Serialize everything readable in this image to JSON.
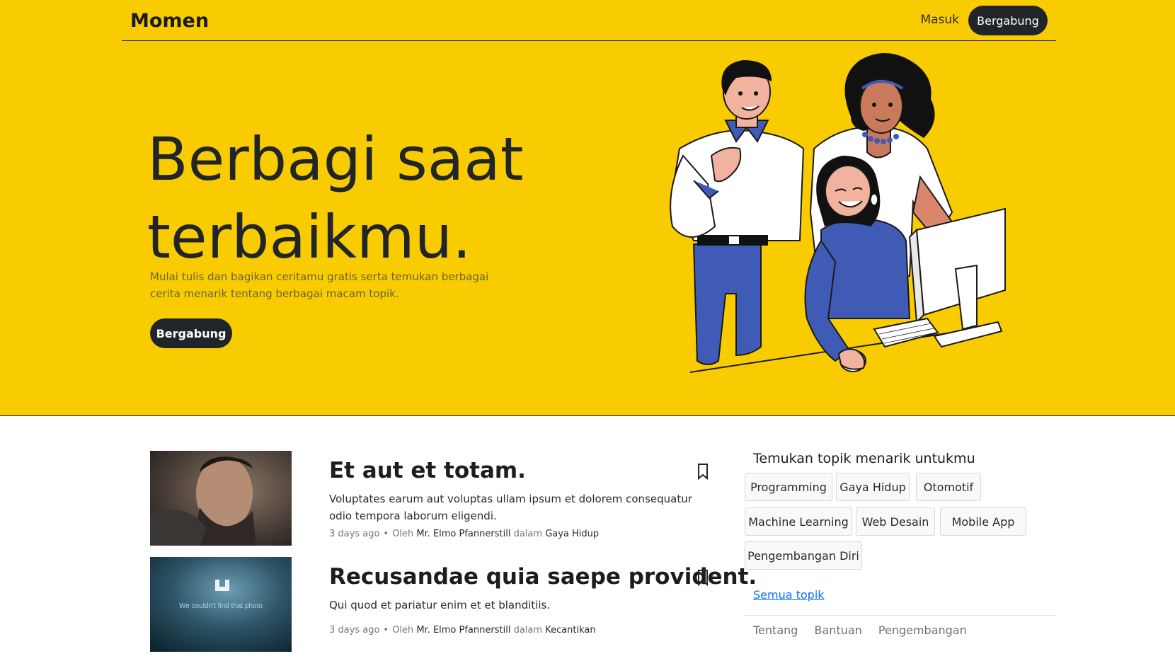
{
  "nav": {
    "brand": "Momen",
    "login": "Masuk",
    "join": "Bergabung"
  },
  "hero": {
    "title_line1": "Berbagi saat",
    "title_line2": "terbaikmu.",
    "subtitle": "Mulai tulis dan bagikan ceritamu gratis serta temukan berbagai cerita menarik tentang berbagai macam topik.",
    "cta": "Bergabung"
  },
  "articles": [
    {
      "title": "Et aut et totam.",
      "excerpt": "Voluptates earum aut voluptas ullam ipsum et dolorem consequatur odio tempora laborum eligendi.",
      "time": "3 days ago",
      "by": "Oleh",
      "author": "Mr. Elmo Pfannerstill",
      "in": "dalam",
      "category": "Gaya Hidup"
    },
    {
      "title": "Recusandae quia saepe provident.",
      "excerpt": "Qui quod et pariatur enim et et blanditiis.",
      "time": "3 days ago",
      "by": "Oleh",
      "author": "Mr. Elmo Pfannerstill",
      "in": "dalam",
      "category": "Kecantikan",
      "thumb_text": "We couldn't find that photo"
    }
  ],
  "sidebar": {
    "heading": "Temukan topik menarik untukmu",
    "topics": [
      "Programming",
      "Gaya Hidup",
      "Otomotif",
      "Machine Learning",
      "Web Desain",
      "Mobile App",
      "Pengembangan Diri"
    ],
    "all_topics": "Semua topik",
    "footer": [
      "Tentang",
      "Bantuan",
      "Pengembangan"
    ]
  },
  "colors": {
    "hero_bg": "#f8cc00",
    "dark": "#212529",
    "link": "#0d6efd",
    "shirt_blue": "#3f5bb5"
  }
}
